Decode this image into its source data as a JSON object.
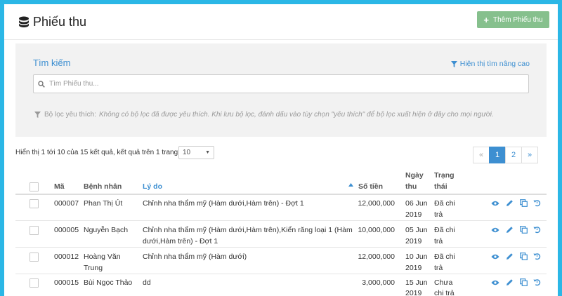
{
  "header": {
    "title": "Phiếu thu",
    "add_button": "Thêm Phiếu thu"
  },
  "search": {
    "title": "Tìm kiếm",
    "advanced_link": "Hiện thị tìm nâng cao",
    "placeholder": "Tìm Phiếu thu...",
    "favorite_label": "Bộ lọc yêu thích:",
    "favorite_text": "Không có bộ lọc đã được yêu thích. Khi lưu bộ lọc, đánh dấu vào tùy chọn \"yêu thích\" để bộ lọc xuất hiện ở đây cho mọi người."
  },
  "results": {
    "info": "Hiển thị 1 tới 10 của 15 kết quả,  kết quả trên 1 trang:",
    "page_size": "10"
  },
  "pagination": [
    "«",
    "1",
    "2",
    "»"
  ],
  "table": {
    "headers": {
      "code": "Mã",
      "patient": "Bệnh nhân",
      "reason": "Lý do",
      "amount": "Số tiền",
      "date_l1": "Ngày",
      "date_l2": "thu",
      "status_l1": "Trạng",
      "status_l2": "thái"
    },
    "rows": [
      {
        "code": "000007",
        "patient_l1": "Phan Thị Út",
        "patient_l2": "",
        "reason_l1": "Chỉnh nha thẩm mỹ (Hàm dưới,Hàm trên) - Đợt 1",
        "reason_l2": "",
        "amount": "12,000,000",
        "date_l1": "06 Jun",
        "date_l2": "2019",
        "status_l1": "Đã chi",
        "status_l2": "trả"
      },
      {
        "code": "000005",
        "patient_l1": "Nguyễn Bạch",
        "patient_l2": "",
        "reason_l1": "Chỉnh nha thẩm mỹ (Hàm dưới,Hàm trên),Kiển răng loại 1 (Hàm",
        "reason_l2": "dưới,Hàm trên) - Đợt 1",
        "amount": "10,000,000",
        "date_l1": "05 Jun",
        "date_l2": "2019",
        "status_l1": "Đã chi",
        "status_l2": "trả"
      },
      {
        "code": "000012",
        "patient_l1": "Hoàng Văn",
        "patient_l2": "Trung",
        "reason_l1": "Chỉnh nha thẩm mỹ (Hàm dưới)",
        "reason_l2": "",
        "amount": "12,000,000",
        "date_l1": "10 Jun",
        "date_l2": "2019",
        "status_l1": "Đã chi",
        "status_l2": "trả"
      },
      {
        "code": "000015",
        "patient_l1": "Bùi Ngọc Thảo",
        "patient_l2": "",
        "reason_l1": "dd",
        "reason_l2": "",
        "amount": "3,000,000",
        "date_l1": "15 Jun",
        "date_l2": "2019",
        "status_l1": "Chưa",
        "status_l2": "chi trả"
      }
    ]
  },
  "icons": [
    "eye-icon",
    "pencil-icon",
    "copy-icon",
    "undo-icon"
  ],
  "colors": {
    "accent": "#3d8fd1",
    "add_button": "#86c08d",
    "frame": "#2bb7e6"
  }
}
